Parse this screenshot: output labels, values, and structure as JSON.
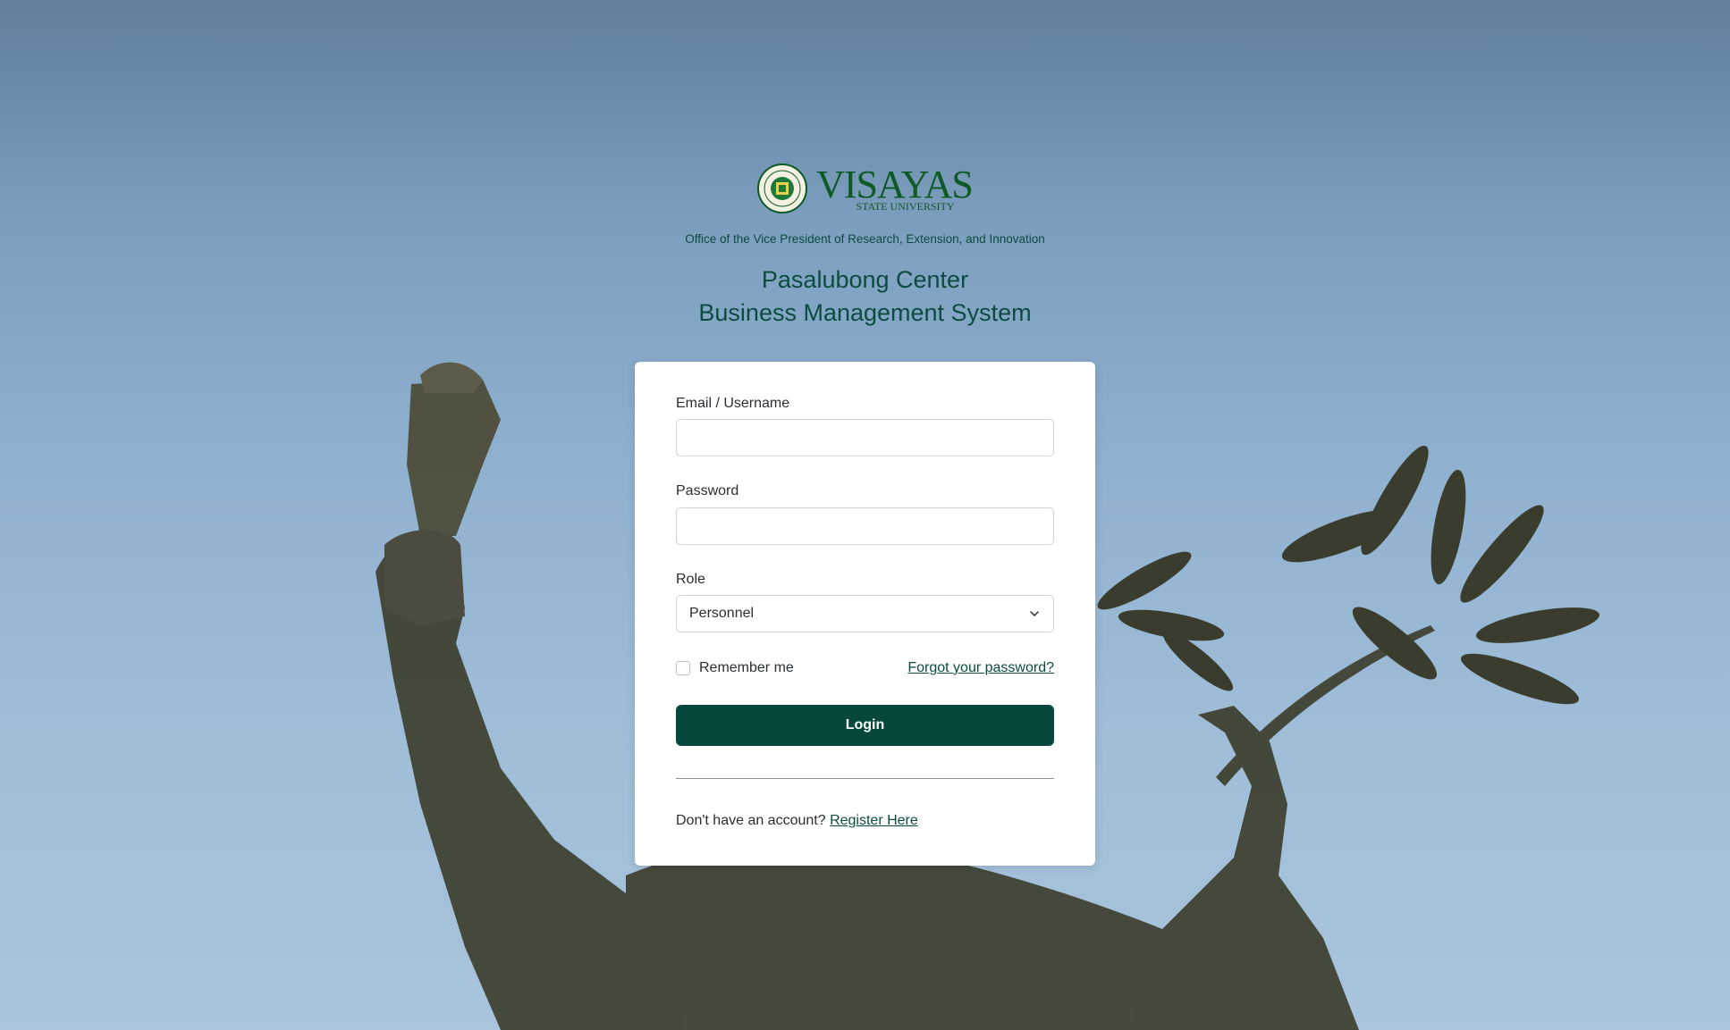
{
  "brand": {
    "logo_main": "VISAYAS",
    "logo_sub": "STATE UNIVERSITY",
    "seal_icon": "university-seal-icon",
    "office": "Office of the Vice President of Research, Extension, and Innovation",
    "title_line1": "Pasalubong Center",
    "title_line2": "Business Management System",
    "primary_color": "#07483c"
  },
  "form": {
    "email_label": "Email / Username",
    "email_value": "",
    "password_label": "Password",
    "password_value": "",
    "role_label": "Role",
    "role_selected": "Personnel",
    "remember_label": "Remember me",
    "forgot_label": "Forgot your password?",
    "login_label": "Login",
    "no_account_text": "Don't have an account?",
    "register_label": "Register Here"
  }
}
